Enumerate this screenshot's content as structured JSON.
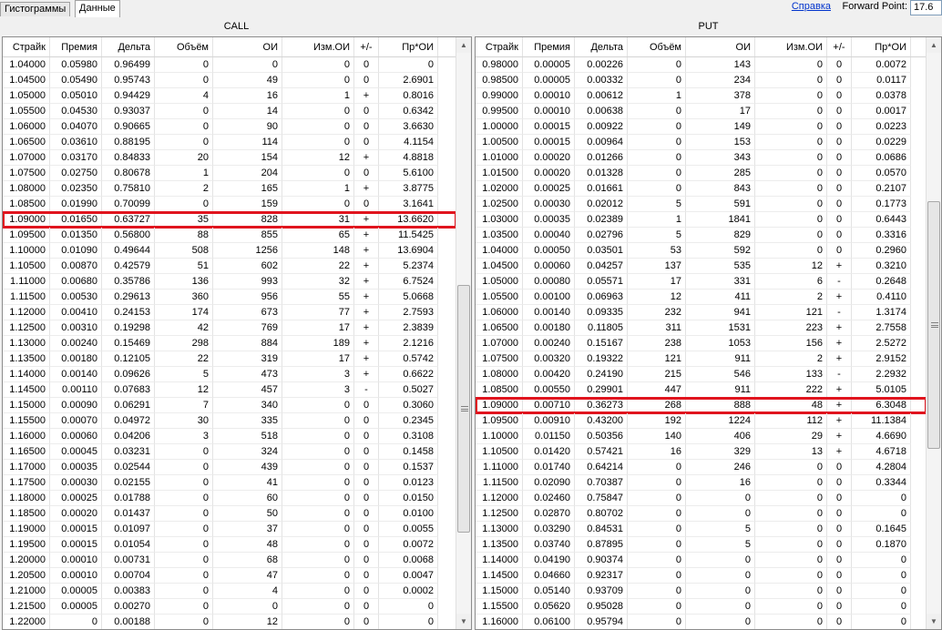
{
  "tabs": [
    "Гистограммы",
    "Данные"
  ],
  "help_link": "Справка",
  "forward_point": {
    "label": "Forward Point:",
    "value": "17.6"
  },
  "columns": [
    "Страйк",
    "Премия",
    "Дельта",
    "Объём",
    "ОИ",
    "Изм.ОИ",
    "+/-",
    "Пр*ОИ"
  ],
  "call": {
    "title": "CALL",
    "highlight_strike": "1.09000",
    "rows": [
      [
        "1.04000",
        "0.05980",
        "0.96499",
        "0",
        "0",
        "0",
        "0",
        "0"
      ],
      [
        "1.04500",
        "0.05490",
        "0.95743",
        "0",
        "49",
        "0",
        "0",
        "2.6901"
      ],
      [
        "1.05000",
        "0.05010",
        "0.94429",
        "4",
        "16",
        "1",
        "+",
        "0.8016"
      ],
      [
        "1.05500",
        "0.04530",
        "0.93037",
        "0",
        "14",
        "0",
        "0",
        "0.6342"
      ],
      [
        "1.06000",
        "0.04070",
        "0.90665",
        "0",
        "90",
        "0",
        "0",
        "3.6630"
      ],
      [
        "1.06500",
        "0.03610",
        "0.88195",
        "0",
        "114",
        "0",
        "0",
        "4.1154"
      ],
      [
        "1.07000",
        "0.03170",
        "0.84833",
        "20",
        "154",
        "12",
        "+",
        "4.8818"
      ],
      [
        "1.07500",
        "0.02750",
        "0.80678",
        "1",
        "204",
        "0",
        "0",
        "5.6100"
      ],
      [
        "1.08000",
        "0.02350",
        "0.75810",
        "2",
        "165",
        "1",
        "+",
        "3.8775"
      ],
      [
        "1.08500",
        "0.01990",
        "0.70099",
        "0",
        "159",
        "0",
        "0",
        "3.1641"
      ],
      [
        "1.09000",
        "0.01650",
        "0.63727",
        "35",
        "828",
        "31",
        "+",
        "13.6620"
      ],
      [
        "1.09500",
        "0.01350",
        "0.56800",
        "88",
        "855",
        "65",
        "+",
        "11.5425"
      ],
      [
        "1.10000",
        "0.01090",
        "0.49644",
        "508",
        "1256",
        "148",
        "+",
        "13.6904"
      ],
      [
        "1.10500",
        "0.00870",
        "0.42579",
        "51",
        "602",
        "22",
        "+",
        "5.2374"
      ],
      [
        "1.11000",
        "0.00680",
        "0.35786",
        "136",
        "993",
        "32",
        "+",
        "6.7524"
      ],
      [
        "1.11500",
        "0.00530",
        "0.29613",
        "360",
        "956",
        "55",
        "+",
        "5.0668"
      ],
      [
        "1.12000",
        "0.00410",
        "0.24153",
        "174",
        "673",
        "77",
        "+",
        "2.7593"
      ],
      [
        "1.12500",
        "0.00310",
        "0.19298",
        "42",
        "769",
        "17",
        "+",
        "2.3839"
      ],
      [
        "1.13000",
        "0.00240",
        "0.15469",
        "298",
        "884",
        "189",
        "+",
        "2.1216"
      ],
      [
        "1.13500",
        "0.00180",
        "0.12105",
        "22",
        "319",
        "17",
        "+",
        "0.5742"
      ],
      [
        "1.14000",
        "0.00140",
        "0.09626",
        "5",
        "473",
        "3",
        "+",
        "0.6622"
      ],
      [
        "1.14500",
        "0.00110",
        "0.07683",
        "12",
        "457",
        "3",
        "-",
        "0.5027"
      ],
      [
        "1.15000",
        "0.00090",
        "0.06291",
        "7",
        "340",
        "0",
        "0",
        "0.3060"
      ],
      [
        "1.15500",
        "0.00070",
        "0.04972",
        "30",
        "335",
        "0",
        "0",
        "0.2345"
      ],
      [
        "1.16000",
        "0.00060",
        "0.04206",
        "3",
        "518",
        "0",
        "0",
        "0.3108"
      ],
      [
        "1.16500",
        "0.00045",
        "0.03231",
        "0",
        "324",
        "0",
        "0",
        "0.1458"
      ],
      [
        "1.17000",
        "0.00035",
        "0.02544",
        "0",
        "439",
        "0",
        "0",
        "0.1537"
      ],
      [
        "1.17500",
        "0.00030",
        "0.02155",
        "0",
        "41",
        "0",
        "0",
        "0.0123"
      ],
      [
        "1.18000",
        "0.00025",
        "0.01788",
        "0",
        "60",
        "0",
        "0",
        "0.0150"
      ],
      [
        "1.18500",
        "0.00020",
        "0.01437",
        "0",
        "50",
        "0",
        "0",
        "0.0100"
      ],
      [
        "1.19000",
        "0.00015",
        "0.01097",
        "0",
        "37",
        "0",
        "0",
        "0.0055"
      ],
      [
        "1.19500",
        "0.00015",
        "0.01054",
        "0",
        "48",
        "0",
        "0",
        "0.0072"
      ],
      [
        "1.20000",
        "0.00010",
        "0.00731",
        "0",
        "68",
        "0",
        "0",
        "0.0068"
      ],
      [
        "1.20500",
        "0.00010",
        "0.00704",
        "0",
        "47",
        "0",
        "0",
        "0.0047"
      ],
      [
        "1.21000",
        "0.00005",
        "0.00383",
        "0",
        "4",
        "0",
        "0",
        "0.0002"
      ],
      [
        "1.21500",
        "0.00005",
        "0.00270",
        "0",
        "0",
        "0",
        "0",
        "0"
      ],
      [
        "1.22000",
        "0",
        "0.00188",
        "0",
        "12",
        "0",
        "0",
        "0"
      ]
    ]
  },
  "put": {
    "title": "PUT",
    "highlight_strike": "1.09000",
    "rows": [
      [
        "0.98000",
        "0.00005",
        "0.00226",
        "0",
        "143",
        "0",
        "0",
        "0.0072"
      ],
      [
        "0.98500",
        "0.00005",
        "0.00332",
        "0",
        "234",
        "0",
        "0",
        "0.0117"
      ],
      [
        "0.99000",
        "0.00010",
        "0.00612",
        "1",
        "378",
        "0",
        "0",
        "0.0378"
      ],
      [
        "0.99500",
        "0.00010",
        "0.00638",
        "0",
        "17",
        "0",
        "0",
        "0.0017"
      ],
      [
        "1.00000",
        "0.00015",
        "0.00922",
        "0",
        "149",
        "0",
        "0",
        "0.0223"
      ],
      [
        "1.00500",
        "0.00015",
        "0.00964",
        "0",
        "153",
        "0",
        "0",
        "0.0229"
      ],
      [
        "1.01000",
        "0.00020",
        "0.01266",
        "0",
        "343",
        "0",
        "0",
        "0.0686"
      ],
      [
        "1.01500",
        "0.00020",
        "0.01328",
        "0",
        "285",
        "0",
        "0",
        "0.0570"
      ],
      [
        "1.02000",
        "0.00025",
        "0.01661",
        "0",
        "843",
        "0",
        "0",
        "0.2107"
      ],
      [
        "1.02500",
        "0.00030",
        "0.02012",
        "5",
        "591",
        "0",
        "0",
        "0.1773"
      ],
      [
        "1.03000",
        "0.00035",
        "0.02389",
        "1",
        "1841",
        "0",
        "0",
        "0.6443"
      ],
      [
        "1.03500",
        "0.00040",
        "0.02796",
        "5",
        "829",
        "0",
        "0",
        "0.3316"
      ],
      [
        "1.04000",
        "0.00050",
        "0.03501",
        "53",
        "592",
        "0",
        "0",
        "0.2960"
      ],
      [
        "1.04500",
        "0.00060",
        "0.04257",
        "137",
        "535",
        "12",
        "+",
        "0.3210"
      ],
      [
        "1.05000",
        "0.00080",
        "0.05571",
        "17",
        "331",
        "6",
        "-",
        "0.2648"
      ],
      [
        "1.05500",
        "0.00100",
        "0.06963",
        "12",
        "411",
        "2",
        "+",
        "0.4110"
      ],
      [
        "1.06000",
        "0.00140",
        "0.09335",
        "232",
        "941",
        "121",
        "-",
        "1.3174"
      ],
      [
        "1.06500",
        "0.00180",
        "0.11805",
        "311",
        "1531",
        "223",
        "+",
        "2.7558"
      ],
      [
        "1.07000",
        "0.00240",
        "0.15167",
        "238",
        "1053",
        "156",
        "+",
        "2.5272"
      ],
      [
        "1.07500",
        "0.00320",
        "0.19322",
        "121",
        "911",
        "2",
        "+",
        "2.9152"
      ],
      [
        "1.08000",
        "0.00420",
        "0.24190",
        "215",
        "546",
        "133",
        "-",
        "2.2932"
      ],
      [
        "1.08500",
        "0.00550",
        "0.29901",
        "447",
        "911",
        "222",
        "+",
        "5.0105"
      ],
      [
        "1.09000",
        "0.00710",
        "0.36273",
        "268",
        "888",
        "48",
        "+",
        "6.3048"
      ],
      [
        "1.09500",
        "0.00910",
        "0.43200",
        "192",
        "1224",
        "112",
        "+",
        "11.1384"
      ],
      [
        "1.10000",
        "0.01150",
        "0.50356",
        "140",
        "406",
        "29",
        "+",
        "4.6690"
      ],
      [
        "1.10500",
        "0.01420",
        "0.57421",
        "16",
        "329",
        "13",
        "+",
        "4.6718"
      ],
      [
        "1.11000",
        "0.01740",
        "0.64214",
        "0",
        "246",
        "0",
        "0",
        "4.2804"
      ],
      [
        "1.11500",
        "0.02090",
        "0.70387",
        "0",
        "16",
        "0",
        "0",
        "0.3344"
      ],
      [
        "1.12000",
        "0.02460",
        "0.75847",
        "0",
        "0",
        "0",
        "0",
        "0"
      ],
      [
        "1.12500",
        "0.02870",
        "0.80702",
        "0",
        "0",
        "0",
        "0",
        "0"
      ],
      [
        "1.13000",
        "0.03290",
        "0.84531",
        "0",
        "5",
        "0",
        "0",
        "0.1645"
      ],
      [
        "1.13500",
        "0.03740",
        "0.87895",
        "0",
        "5",
        "0",
        "0",
        "0.1870"
      ],
      [
        "1.14000",
        "0.04190",
        "0.90374",
        "0",
        "0",
        "0",
        "0",
        "0"
      ],
      [
        "1.14500",
        "0.04660",
        "0.92317",
        "0",
        "0",
        "0",
        "0",
        "0"
      ],
      [
        "1.15000",
        "0.05140",
        "0.93709",
        "0",
        "0",
        "0",
        "0",
        "0"
      ],
      [
        "1.15500",
        "0.05620",
        "0.95028",
        "0",
        "0",
        "0",
        "0",
        "0"
      ],
      [
        "1.16000",
        "0.06100",
        "0.95794",
        "0",
        "0",
        "0",
        "0",
        "0"
      ]
    ]
  },
  "colors": {
    "highlight_border": "#e0141e",
    "link": "#0033cc"
  }
}
